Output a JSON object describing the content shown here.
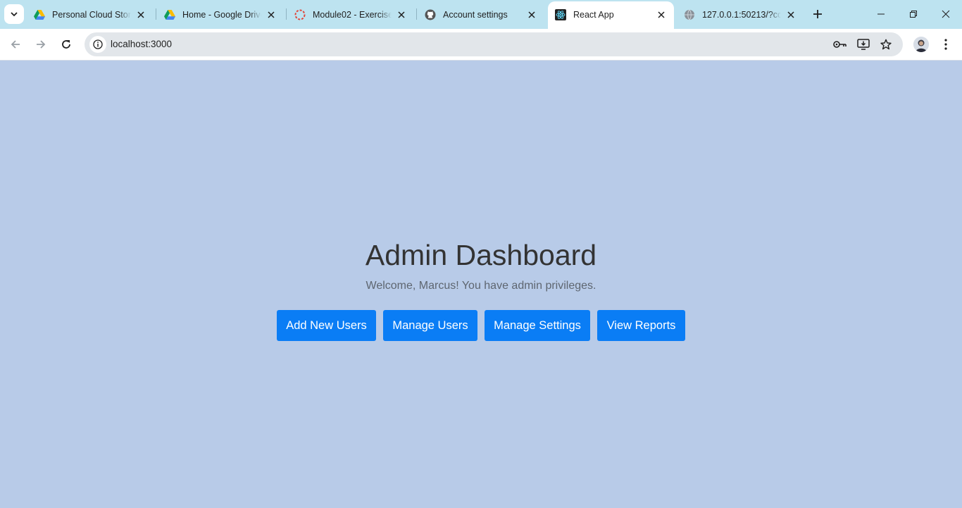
{
  "browser": {
    "tabs": [
      {
        "title": "Personal Cloud Storage",
        "icon": "google-drive-icon",
        "active": false
      },
      {
        "title": "Home - Google Drive",
        "icon": "google-drive-icon",
        "active": false
      },
      {
        "title": "Module02 - Exercise01",
        "icon": "loading-spinner-icon",
        "active": false
      },
      {
        "title": "Account settings",
        "icon": "github-icon",
        "active": false
      },
      {
        "title": "React App",
        "icon": "react-icon",
        "active": true
      },
      {
        "title": "127.0.0.1:50213/?code=",
        "icon": "globe-icon",
        "active": false
      }
    ],
    "address": {
      "url": "localhost:3000"
    }
  },
  "page": {
    "title": "Admin Dashboard",
    "welcome": "Welcome, Marcus! You have admin privileges.",
    "buttons": {
      "add_users": "Add New Users",
      "manage_users": "Manage Users",
      "manage_settings": "Manage Settings",
      "view_reports": "View Reports"
    }
  },
  "colors": {
    "page_background": "#b8cbe8",
    "button_primary": "#0a7df5",
    "tabstrip": "#bde3f0"
  }
}
